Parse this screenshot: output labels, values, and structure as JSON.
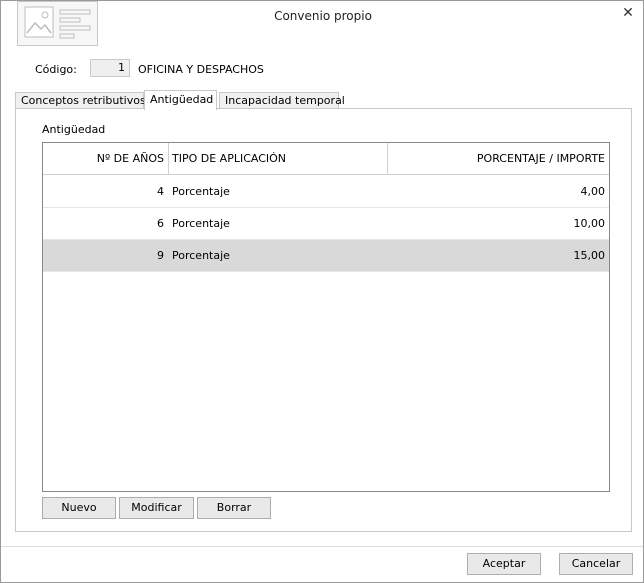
{
  "window": {
    "title": "Convenio propio",
    "close_icon": "✕"
  },
  "header": {
    "code_label": "Código:",
    "code_value": "1",
    "code_description": "OFICINA Y DESPACHOS"
  },
  "tabs": [
    {
      "label": "Conceptos retributivos"
    },
    {
      "label": "Antigüedad"
    },
    {
      "label": "Incapacidad temporal"
    }
  ],
  "section": {
    "title": "Antigüedad"
  },
  "table": {
    "columns": [
      "Nº DE AÑOS",
      "TIPO DE APLICACIÓN",
      "PORCENTAJE / IMPORTE"
    ],
    "rows": [
      {
        "years": "4",
        "type": "Porcentaje",
        "amount": "4,00"
      },
      {
        "years": "6",
        "type": "Porcentaje",
        "amount": "10,00"
      },
      {
        "years": "9",
        "type": "Porcentaje",
        "amount": "15,00"
      }
    ]
  },
  "actions": {
    "new": "Nuevo",
    "edit": "Modificar",
    "delete": "Borrar"
  },
  "footer": {
    "accept": "Aceptar",
    "cancel": "Cancelar"
  }
}
